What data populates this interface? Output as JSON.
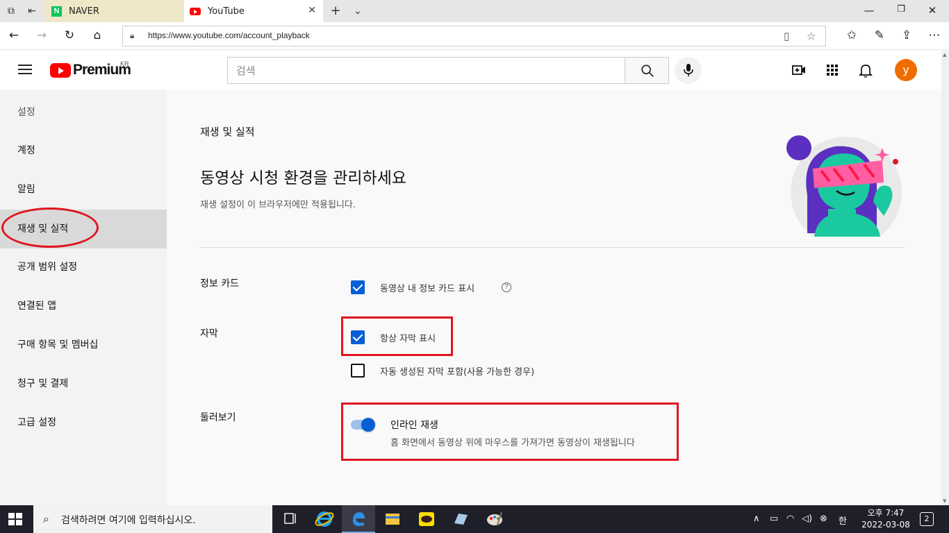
{
  "browser": {
    "tabs": [
      {
        "label": "NAVER"
      },
      {
        "label": "YouTube"
      }
    ],
    "url": "https://www.youtube.com/account_playback"
  },
  "header": {
    "logo_text": "Premium",
    "region": "KR",
    "search_placeholder": "검색",
    "avatar_letter": "y"
  },
  "sidebar": {
    "title": "설정",
    "items": [
      {
        "label": "계정"
      },
      {
        "label": "알림"
      },
      {
        "label": "재생 및 실적"
      },
      {
        "label": "공개 범위 설정"
      },
      {
        "label": "연결된 앱"
      },
      {
        "label": "구매 항목 및 멤버십"
      },
      {
        "label": "청구 및 결제"
      },
      {
        "label": "고급 설정"
      }
    ],
    "active_index": 2
  },
  "main": {
    "section_title": "재생 및 실적",
    "heading": "동영상 시청 환경을 관리하세요",
    "subheading": "재생 설정이 이 브라우저에만 적용됩니다.",
    "info_cards": {
      "label": "정보 카드",
      "option": "동영상 내 정보 카드 표시",
      "checked": true
    },
    "captions": {
      "label": "자막",
      "option1": "항상 자막 표시",
      "option1_checked": true,
      "option2": "자동 생성된 자막 포함(사용 가능한 경우)",
      "option2_checked": false
    },
    "browse": {
      "label": "둘러보기",
      "toggle_title": "인라인 재생",
      "toggle_desc": "홈 화면에서 동영상 위에 마우스를 가져가면 동영상이 재생됩니다",
      "enabled": true
    }
  },
  "taskbar": {
    "search_text": "검색하려면 여기에 입력하십시오.",
    "ime": "한",
    "time": "오후 7:47",
    "date": "2022-03-08",
    "notification_count": "2"
  },
  "colors": {
    "accent_blue": "#065fd4",
    "youtube_red": "#ff0000",
    "annotation_red": "#e0141e",
    "avatar": "#ef6c00"
  }
}
